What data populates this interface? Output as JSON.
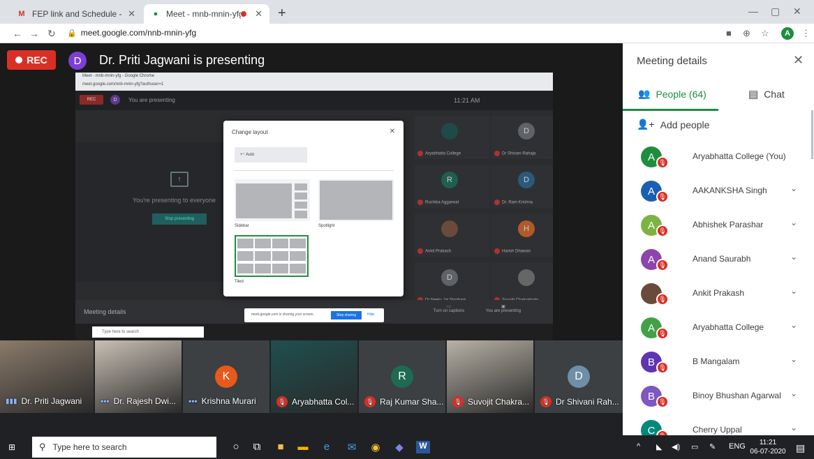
{
  "browser": {
    "tabs": [
      {
        "title": "FEP link and Schedule - training (",
        "icon": "gmail-icon"
      },
      {
        "title": "Meet - mnb-mnin-yfg",
        "icon": "meet-icon",
        "recording": true
      }
    ],
    "url": "meet.google.com/nnb-mnin-yfg",
    "profile_initial": "A"
  },
  "stage": {
    "rec_label": "REC",
    "presenter_initial": "D",
    "presenting_text": "Dr. Priti Jagwani is presenting"
  },
  "shared_screen": {
    "tab_title": "Meet - mnb-mnin-yfg - Google Chrome",
    "url": "meet.google.com/nnb-mnin-yfg?authuser=1",
    "rec": "REC",
    "initial": "D",
    "you_presenting": "You are presenting",
    "time": "11:21 AM",
    "presenting_to": "You're presenting to everyone",
    "stop_presenting": "Stop presenting",
    "meeting_details": "Meeting details",
    "captions": "Turn on captions",
    "you_are_presenting_btn": "You are presenting",
    "sharing_msg": "meet.google.com is sharing your screen.",
    "stop_sharing": "Stop sharing",
    "hide": "Hide",
    "taskbar_search": "Type here to search",
    "mini_tiles": [
      {
        "name": "Aryabhatta College",
        "initial": "",
        "color": "#1f4a4a"
      },
      {
        "name": "Dr Shivani Rahaja",
        "initial": "D",
        "color": "#5f6368"
      },
      {
        "name": "Ruchika Aggarwal",
        "initial": "R",
        "color": "#1f5f4f"
      },
      {
        "name": "Dr. Ram Krishna",
        "initial": "D",
        "color": "#2a5a7a"
      },
      {
        "name": "Ankit Prakash",
        "initial": "",
        "color": "#6a4a3a"
      },
      {
        "name": "Harish Dhawan",
        "initial": "H",
        "color": "#b05a2a"
      },
      {
        "name": "Dr Neetu Jai Singhani",
        "initial": "D",
        "color": "#5f6368"
      },
      {
        "name": "Suvojit Chakraborty",
        "initial": "",
        "color": "#666"
      }
    ]
  },
  "layout_dialog": {
    "title": "Change layout",
    "auto": "Auto",
    "sidebar": "Sidebar",
    "spotlight": "Spotlight",
    "tiled": "Tiled"
  },
  "strip": [
    {
      "name": "Dr. Priti Jagwani",
      "type": "video",
      "color": "#8a7a6a",
      "indicator": "speaking"
    },
    {
      "name": "Dr. Rajesh Dwi...",
      "type": "video",
      "color": "#c9c0b4",
      "indicator": "dots"
    },
    {
      "name": "Krishna Murari",
      "type": "avatar",
      "initial": "K",
      "color": "#e8591a",
      "indicator": "dots"
    },
    {
      "name": "Aryabhatta Col...",
      "type": "video",
      "color": "#1f4f4f",
      "indicator": "muted"
    },
    {
      "name": "Raj Kumar Sha...",
      "type": "avatar",
      "initial": "R",
      "color": "#1e6b52",
      "indicator": "muted"
    },
    {
      "name": "Suvojit Chakra...",
      "type": "video",
      "color": "#b8b2a6",
      "indicator": "muted"
    },
    {
      "name": "Dr Shivani Rah...",
      "type": "avatar",
      "initial": "D",
      "color": "#6f8fa8",
      "indicator": "muted"
    }
  ],
  "panel": {
    "title": "Meeting details",
    "people_tab": "People (64)",
    "chat_tab": "Chat",
    "add_people": "Add people",
    "participants": [
      {
        "initial": "A",
        "name": "Aryabhatta College (You)",
        "color": "#1e8e3e",
        "expandable": false
      },
      {
        "initial": "A",
        "name": "AAKANKSHA Singh",
        "color": "#1a5fb4",
        "expandable": true
      },
      {
        "initial": "A",
        "name": "Abhishek Parashar",
        "color": "#7cb342",
        "expandable": true
      },
      {
        "initial": "A",
        "name": "Anand Saurabh",
        "color": "#8e44ad",
        "expandable": true
      },
      {
        "initial": "",
        "name": "Ankit Prakash",
        "color": "#6a4a3a",
        "expandable": true
      },
      {
        "initial": "A",
        "name": "Aryabhatta College",
        "color": "#43a047",
        "expandable": true
      },
      {
        "initial": "B",
        "name": "B Mangalam",
        "color": "#5e35b1",
        "expandable": true
      },
      {
        "initial": "B",
        "name": "Binoy Bhushan Agarwal",
        "color": "#7e57c2",
        "expandable": true
      },
      {
        "initial": "C",
        "name": "Cherry Uppal",
        "color": "#00897b",
        "expandable": true
      }
    ]
  },
  "taskbar": {
    "search_placeholder": "Type here to search",
    "lang": "ENG",
    "time": "11:21",
    "date": "06-07-2020"
  }
}
